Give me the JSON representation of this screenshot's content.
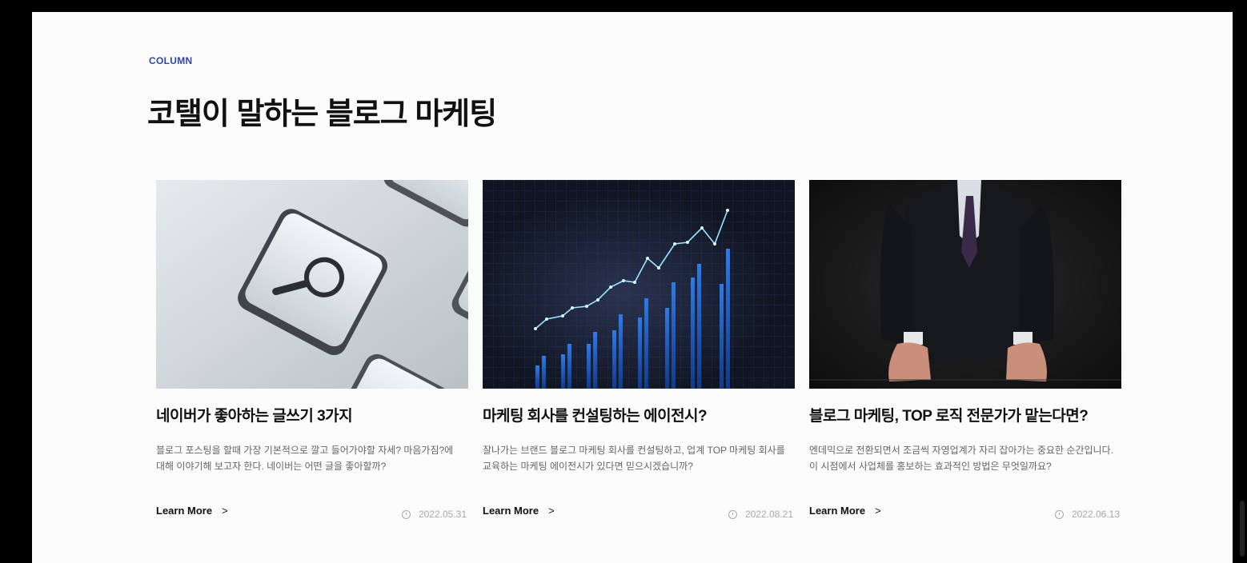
{
  "section": {
    "eyebrow": "COLUMN",
    "title": "코탤이 말하는 블로그 마케팅"
  },
  "cards": [
    {
      "image": "magnifier-key-photo",
      "title": "네이버가 좋아하는 글쓰기 3가지",
      "excerpt": "블로그 포스팅을 할때 가장 기본적으로 깔고 들어가야할 자세? 마음가짐?에 대해 이야기해 보고자 한다. 네이버는 어떤 글을 좋아할까?",
      "more_label": "Learn More",
      "more_icon": "chevron-right-icon",
      "date": "2022.05.31"
    },
    {
      "image": "growth-chart-photo",
      "title": "마케팅 회사를 컨설팅하는 에이전시?",
      "excerpt": "잘나가는 브랜드 블로그 마케팅 회사를 컨설팅하고, 업계 TOP 마케팅 회사를 교육하는 마케팅 에이전시가 있다면 믿으시겠습니까?",
      "more_label": "Learn More",
      "more_icon": "chevron-right-icon",
      "date": "2022.08.21"
    },
    {
      "image": "businessman-photo",
      "title": "블로그 마케팅, TOP 로직 전문가가 맡는다면?",
      "excerpt": "엔데믹으로 전환되면서 조금씩 자영업계가 자리 잡아가는 중요한 순간입니다. 이 시점에서 사업체를 홍보하는 효과적인 방법은 무엇일까요?",
      "more_label": "Learn More",
      "more_icon": "chevron-right-icon",
      "date": "2022.06.13"
    }
  ],
  "colors": {
    "accent": "#2f45a8",
    "text": "#111111",
    "muted": "#666666",
    "backdrop": "#000000",
    "page": "#fbfbfb"
  }
}
